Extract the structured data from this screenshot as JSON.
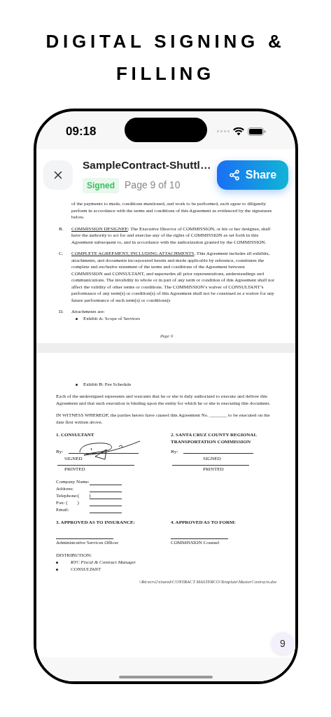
{
  "headline": "DIGITAL SIGNING & FILLING",
  "status_bar": {
    "time": "09:18"
  },
  "header": {
    "title": "SampleContract-Shuttl…",
    "status": "Signed",
    "page_info": "Page 9 of 10",
    "share_button": "Share"
  },
  "page_one": {
    "items": [
      {
        "kind": "text",
        "text": "of the payments to made, conditions mentioned, and work to be performed, each agree to diligently perform in accordance with the terms and conditions of this Agreement as evidenced by the signatures below."
      },
      {
        "kind": "lettered",
        "letter": "B.",
        "heading": "COMMISSION DESIGNEE",
        "text": ": The Executive Director of COMMISSION, or his or her designee, shall have the authority to act for and exercise any of the rights of COMMISSION as set forth in this Agreement subsequent to, and in accordance with the authorization granted by the COMMISSION."
      },
      {
        "kind": "lettered",
        "letter": "C.",
        "heading": "COMPLETE AGREEMENT, INCLUDING ATTACHMENTS",
        "text": ". This Agreement includes all exhibits, attachments, and documents incorporated herein and made applicable by reference, constitutes the complete and exclusive statement of the terms and conditions of the Agreement between COMMISSION and CONSULTANT, and supersedes all prior representations, understandings and communications.  The invalidity in whole or in part of any term or condition of this Agreement shall not affect the validity of other terms or conditions. The COMMISSION’s waiver of CONSULTANT’s performance of any term(s) or condition(s) of this Agreement shall not be construed as a waiver for any future performance of such term(s) or conditions(s"
      },
      {
        "kind": "lettered",
        "letter": "D.",
        "text": "Attachments are:"
      },
      {
        "kind": "bullet",
        "text": "Exhibit A: Scope of Services"
      }
    ],
    "page_label": "Page 9"
  },
  "page_two": {
    "bullet": "Exhibit B: Fee Schedule",
    "paragraphs": [
      "Each of the undersigned represents and warrants that he or she is duly authorized to execute and deliver this Agreement and that such execution is binding upon the entity for which he or she is executing this document.",
      "IN WITNESS WHEREOF, the parties hereto have caused this Agreement No. _______ to be executed on the date first written above."
    ],
    "signatories": [
      {
        "heading": "1. CONSULTANT",
        "by": "By:",
        "signed_label": "SIGNED",
        "printed_label": "PRINTED",
        "signed": true
      },
      {
        "heading": "2. SANTA CRUZ COUNTY REGIONAL TRANSPORTATION COMMISSION",
        "by": "By:",
        "signed_label": "SIGNED",
        "printed_label": "PRINTED",
        "signed": false
      }
    ],
    "contact_fields": [
      "Company Name:",
      "Address:",
      "Telephone:(        )",
      "Fax: (        )",
      "Email:"
    ],
    "approvals": [
      {
        "heading": "3. APPROVED AS TO INSURANCE:",
        "role": "Administrative Services Officer"
      },
      {
        "heading": "4. APPROVED AS TO FORM:",
        "role": "COMMISSION Counsel"
      }
    ],
    "distribution": {
      "heading": "DISTRIBUTION:",
      "items": [
        "RTC Fiscal & Contract Manager",
        "CONSULTANT"
      ]
    },
    "file_path": "\\\\Rtcserv2\\shared\\CONTRACT MASTERCO\\Template\\MasterContracts.doc"
  },
  "page_indicator": "9"
}
